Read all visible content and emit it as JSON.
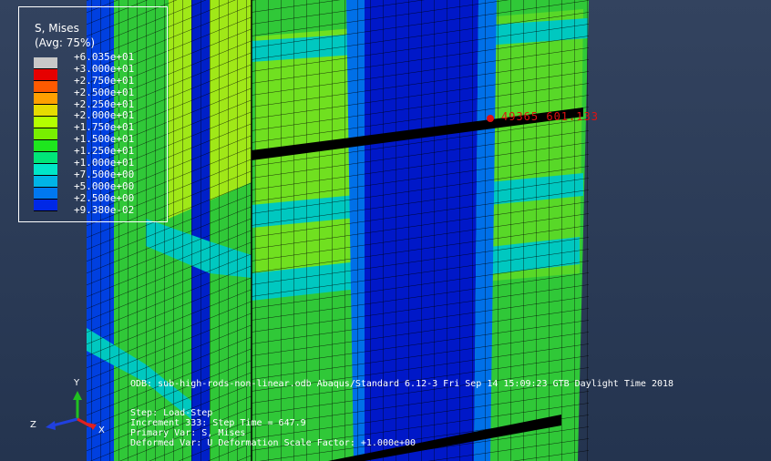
{
  "legend": {
    "title": "S, Mises",
    "avg": "(Avg: 75%)",
    "entries": [
      {
        "label": "+6.035e+01",
        "color": "#c8c8c8"
      },
      {
        "label": "+3.000e+01",
        "color": "#e60000"
      },
      {
        "label": "+2.750e+01",
        "color": "#ff5a00"
      },
      {
        "label": "+2.500e+01",
        "color": "#ffa000"
      },
      {
        "label": "+2.250e+01",
        "color": "#e6dc00"
      },
      {
        "label": "+2.000e+01",
        "color": "#b4ff00"
      },
      {
        "label": "+1.750e+01",
        "color": "#78f000"
      },
      {
        "label": "+1.500e+01",
        "color": "#1ee61e"
      },
      {
        "label": "+1.250e+01",
        "color": "#00e678"
      },
      {
        "label": "+1.000e+01",
        "color": "#00e6c8"
      },
      {
        "label": "+7.500e+00",
        "color": "#00b4e6"
      },
      {
        "label": "+5.000e+00",
        "color": "#0078f0"
      },
      {
        "label": "+2.500e+00",
        "color": "#0028e6"
      },
      {
        "label": "+9.380e-02",
        "color": "#0000b4"
      }
    ]
  },
  "probe": {
    "label": "49365  601.133",
    "color": "#e01010"
  },
  "info": {
    "odb_line": "ODB: sub-high-rods-non-linear.odb    Abaqus/Standard 6.12-3    Fri Sep 14 15:09:23 GTB Daylight Time 2018",
    "step_line": "Step: Load-Step",
    "increment_line": "Increment    333: Step Time =    647.9",
    "primary_var_line": "Primary Var: S, Mises",
    "deformed_line": "Deformed Var: U   Deformation Scale Factor: +1.000e+00"
  },
  "triad": {
    "x_label": "X",
    "y_label": "Y",
    "z_label": "Z"
  }
}
